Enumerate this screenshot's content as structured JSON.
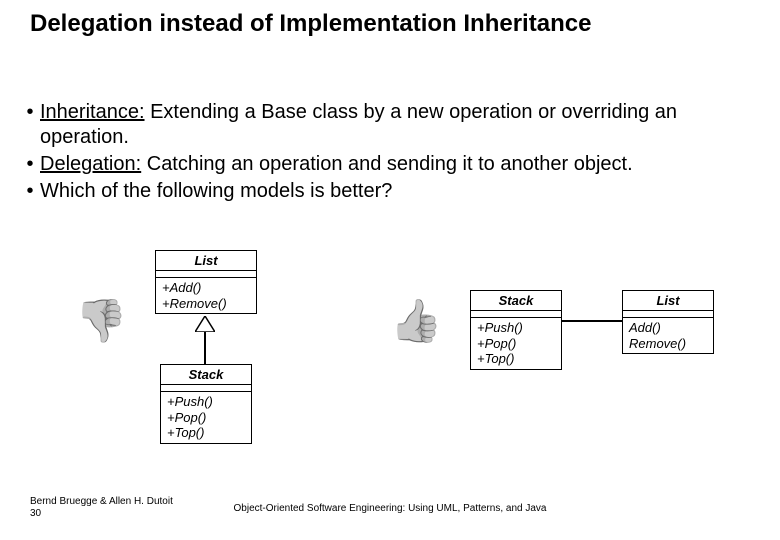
{
  "title": "Delegation instead of Implementation Inheritance",
  "bullets": [
    {
      "term": "Inheritance:",
      "rest": " Extending a Base class by a new operation or overriding an operation."
    },
    {
      "term": "Delegation:",
      "rest": " Catching an operation and sending it to another object."
    },
    {
      "term": "",
      "rest": "Which of the following models is better?"
    }
  ],
  "uml": {
    "left_list": {
      "name": "List",
      "ops": "+Add()\n+Remove()"
    },
    "left_stack": {
      "name": "Stack",
      "ops": "+Push()\n+Pop()\n+Top()"
    },
    "right_stack": {
      "name": "Stack",
      "ops": "+Push()\n+Pop()\n+Top()"
    },
    "right_list": {
      "name": "List",
      "ops": "Add()\nRemove()"
    }
  },
  "thumbs": {
    "down": "👎",
    "up": "👍"
  },
  "footer": {
    "authors": "Bernd Bruegge & Allen H. Dutoit",
    "page": "30",
    "book": "Object-Oriented Software Engineering: Using UML, Patterns, and Java"
  }
}
